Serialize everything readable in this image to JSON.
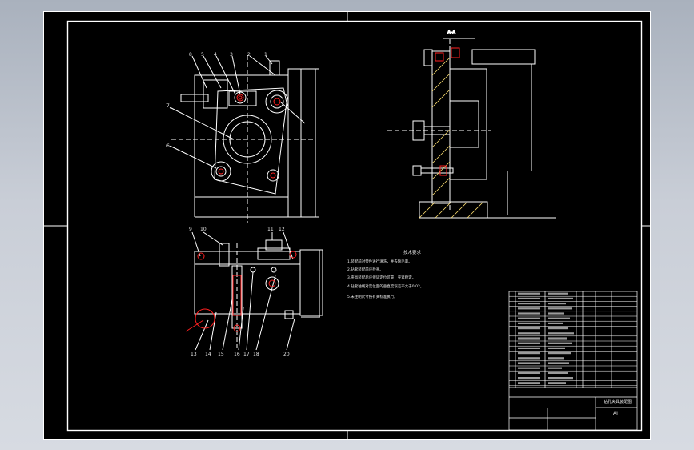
{
  "drawing": {
    "section_label": "A-A",
    "scale_label": "AI",
    "title_block_caption": "钻孔夹具装配图",
    "tech_requirements_title": "技术要求",
    "tech_requirements": [
      "1.装配前对零件进行清洗，并去除毛刺。",
      "2.钻套装配前应检查。",
      "3.夹具装配后应保证定位可靠，夹紧稳定。",
      "4.钻套轴线对定位面的垂直度误差不大于0.02。",
      "5.未注明尺寸按有关标准执行。"
    ]
  },
  "colors": {
    "background": "#000000",
    "line": "#ffffff",
    "part": "#ff2020",
    "hatch": "#ffe070",
    "viewport": "#c8cdd6"
  },
  "balloons_front": [
    "8",
    "5",
    "4",
    "3",
    "2",
    "1",
    "7",
    "6"
  ],
  "balloons_plan": [
    "9",
    "10",
    "11",
    "12"
  ],
  "balloons_bottom": [
    "13",
    "14",
    "15",
    "16",
    "17",
    "18",
    "20"
  ]
}
